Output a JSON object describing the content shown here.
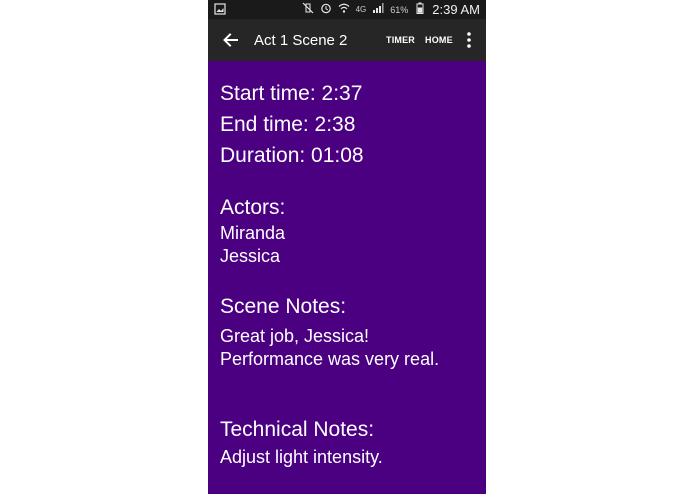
{
  "status_bar": {
    "battery": "61%",
    "time": "2:39 AM",
    "network": "4G"
  },
  "app_bar": {
    "title": "Act 1 Scene 2",
    "actions": [
      "TIMER",
      "HOME"
    ]
  },
  "scene": {
    "start_time": "Start time: 2:37",
    "end_time": "End time: 2:38",
    "duration": "Duration: 01:08",
    "actors_heading": "Actors:",
    "actors": [
      "Miranda",
      "Jessica"
    ],
    "scene_notes_heading": "Scene Notes:",
    "scene_notes_lines": [
      "Great job, Jessica!",
      "Performance was very real."
    ],
    "technical_notes_heading": "Technical Notes:",
    "technical_notes_lines": [
      "Adjust light intensity."
    ]
  },
  "colors": {
    "background": "#4b0082",
    "app_bar": "#262626",
    "status_bar": "#1a1a1a",
    "text": "#ffffff"
  },
  "icons": {
    "status": [
      "image-notification-icon",
      "vibrate-mute-icon",
      "alarm-icon",
      "wifi-icon",
      "signal-icon",
      "battery-icon"
    ],
    "app_bar": [
      "back-arrow-icon",
      "overflow-menu-icon"
    ]
  }
}
